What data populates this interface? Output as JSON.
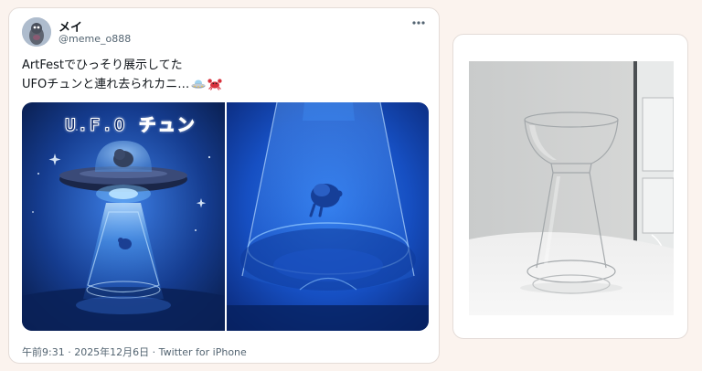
{
  "tweet": {
    "display_name": "メイ",
    "handle": "@meme_o888",
    "text_line1": "ArtFestでひっそり展示してた",
    "text_line2": "UFOチュンと連れ去られカニ…",
    "emojis": [
      "flying-saucer-emoji",
      "crab-emoji"
    ],
    "media_title": "U.F.O チュン",
    "timestamp": "午前9:31 · 2025年12月6日 · Twitter for iPhone",
    "more_icon": "more-icon"
  },
  "colors": {
    "page_bg": "#fbf3ee",
    "card_bg": "#ffffff",
    "text_primary": "#0f1419",
    "text_secondary": "#536471",
    "ufo_blue": "#1e5bd6"
  }
}
